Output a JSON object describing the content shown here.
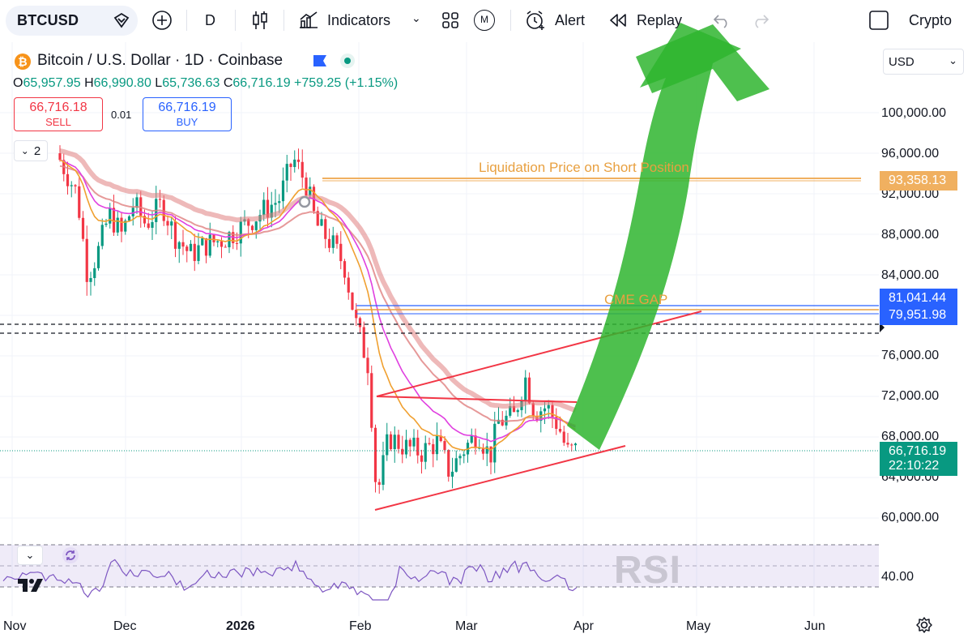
{
  "toolbar": {
    "symbol": "BTCUSD",
    "interval": "D",
    "indicators_label": "Indicators",
    "template_badge": "M",
    "alert_label": "Alert",
    "replay_label": "Replay",
    "market_label": "Crypto"
  },
  "chart_header": {
    "title": "Bitcoin / U.S. Dollar · 1D · Coinbase",
    "ohlc": {
      "o_label": "O",
      "o": "65,957.95",
      "h_label": "H",
      "h": "66,990.80",
      "l_label": "L",
      "l": "65,736.63",
      "c_label": "C",
      "c": "66,716.19",
      "change": "+759.25 (+1.15%)"
    }
  },
  "trade_panel": {
    "sell_price": "66,716.18",
    "sell_label": "SELL",
    "spread": "0.01",
    "buy_price": "66,716.19",
    "buy_label": "BUY"
  },
  "collapse_count": "2",
  "currency": "USD",
  "price_axis": {
    "labels": [
      "100,000.00",
      "96,000.00",
      "92,000.00",
      "88,000.00",
      "84,000.00",
      "76,000.00",
      "72,000.00",
      "68,000.00",
      "64,000.00",
      "60,000.00"
    ],
    "tag_liquidation": "93,358.13",
    "tag_cme_top": "81,041.44",
    "tag_cme_bottom": "79,951.98",
    "tag_last_price": "66,716.19",
    "tag_countdown": "22:10:22"
  },
  "annotations": {
    "liquidation": "Liquidation Price on Short Position",
    "cme_gap": "CME GAP"
  },
  "rsi": {
    "watermark": "RSI",
    "level": "40.00"
  },
  "x_axis": {
    "labels": [
      "Nov",
      "Dec",
      "2026",
      "Feb",
      "Mar",
      "Apr",
      "May",
      "Jun"
    ]
  },
  "colors": {
    "up": "#089981",
    "down": "#f23645",
    "ema_orange": "#f0a030",
    "ema_magenta": "#e040e0",
    "ribbon": "#e08080",
    "arrow": "#2fb52f",
    "liquidation_line": "#f0b060",
    "cme_blue": "#2962ff"
  },
  "icons": {
    "symbol_search": "search-icon",
    "add": "plus-circle-icon",
    "candles": "candlestick-icon",
    "indicators": "indicators-icon",
    "layout": "layout-grid-icon",
    "alert": "alarm-clock-icon",
    "replay": "replay-icon",
    "undo": "undo-icon",
    "redo": "redo-icon",
    "fullscreen": "square-icon",
    "settings": "gear-icon"
  }
}
